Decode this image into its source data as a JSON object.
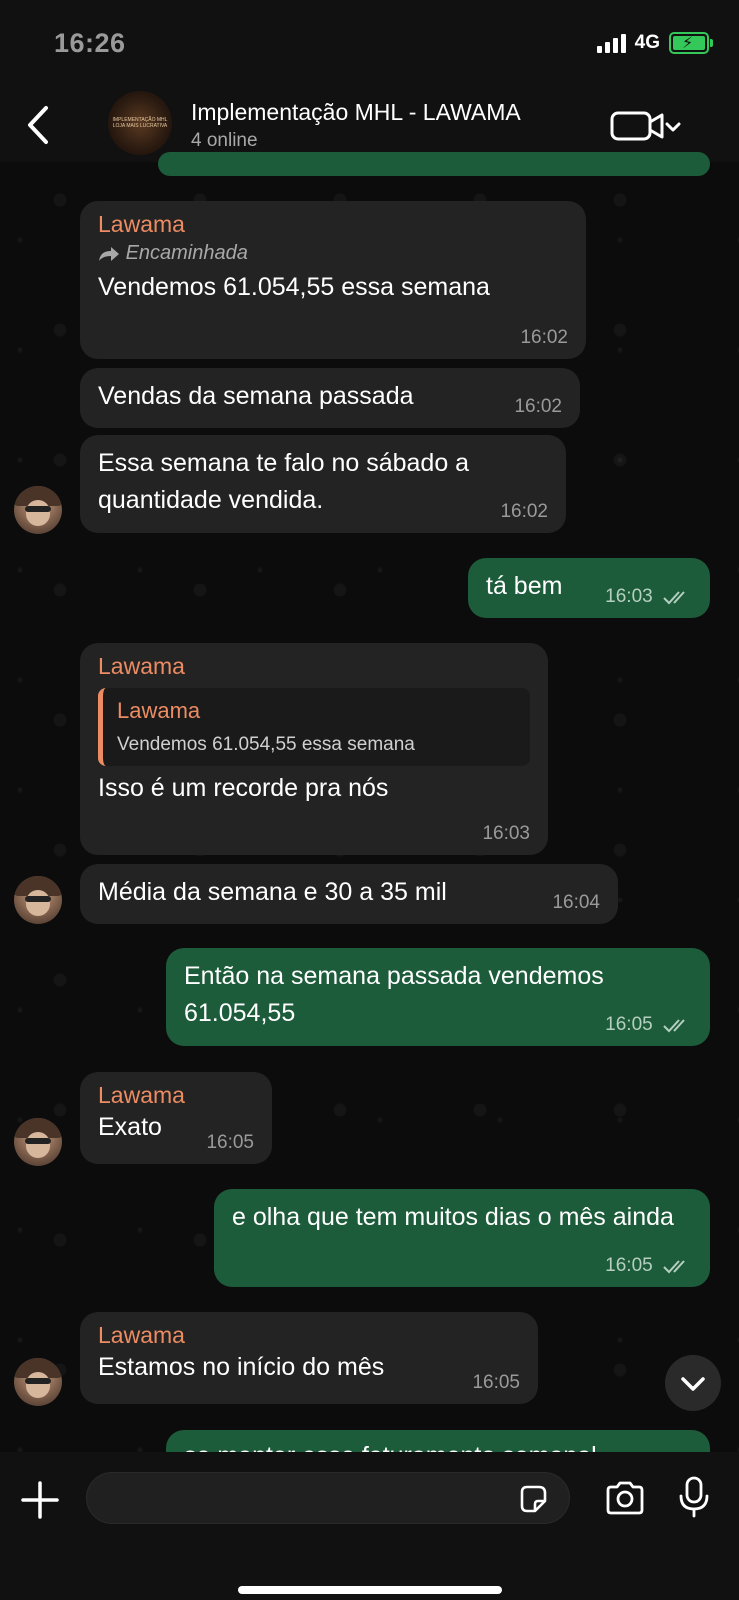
{
  "status_bar": {
    "time": "16:26",
    "network": "4G"
  },
  "header": {
    "title": "Implementação MHL -  LAWAMA",
    "subtitle": "4 online",
    "group_logo_text": "IMPLEMENTAÇÃO MHL\nLOJA MAIS LUCRATIVA"
  },
  "messages": [
    {
      "sender": "Lawama",
      "forwarded": "Encaminhada",
      "text": "Vendemos 61.054,55 essa semana",
      "time": "16:02"
    },
    {
      "text": "Vendas da semana passada",
      "time": "16:02"
    },
    {
      "text": "Essa semana te falo no sábado a quantidade vendida.",
      "time": "16:02"
    },
    {
      "text": "tá bem",
      "time": "16:03"
    },
    {
      "sender": "Lawama",
      "quote_sender": "Lawama",
      "quote_text": "Vendemos 61.054,55 essa semana",
      "text": "Isso é um recorde pra nós",
      "time": "16:03"
    },
    {
      "text": "Média da semana e 30 a 35 mil",
      "time": "16:04"
    },
    {
      "text": "Então na semana passada vendemos 61.054,55",
      "time": "16:05"
    },
    {
      "sender": "Lawama",
      "text": "Exato",
      "time": "16:05"
    },
    {
      "text": "e olha que tem muitos dias o mês ainda",
      "time": "16:05"
    },
    {
      "sender": "Lawama",
      "text": "Estamos no início do mês",
      "time": "16:05"
    },
    {
      "text": "se manter esse faturamento semanal"
    }
  ],
  "composer": {
    "placeholder": ""
  },
  "colors": {
    "outgoing": "#1c5c3a",
    "incoming": "#232323",
    "sender_name": "#ec8c63"
  },
  "icons": [
    "back-chevron-icon",
    "video-call-icon",
    "chevron-down-icon",
    "plus-icon",
    "sticker-icon",
    "camera-icon",
    "microphone-icon",
    "double-check-icon"
  ]
}
